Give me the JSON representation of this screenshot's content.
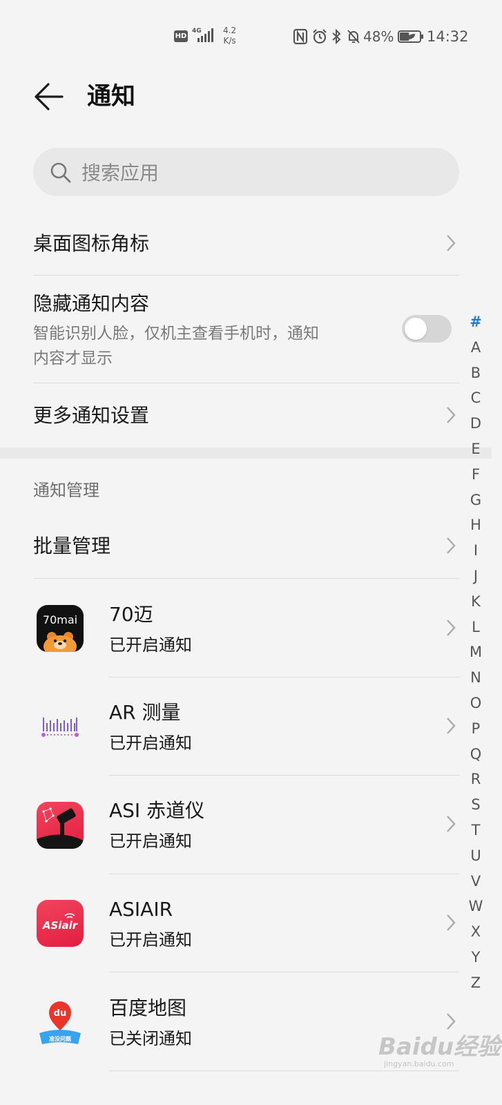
{
  "status_bar": {
    "hd": "HD",
    "network": "4G",
    "speed_value": "4.2",
    "speed_unit": "K/s",
    "battery": "48%",
    "battery_level": 0.48,
    "time": "14:32"
  },
  "header": {
    "title": "通知"
  },
  "search": {
    "placeholder": "搜索应用"
  },
  "settings": {
    "badge_label": "桌面图标角标",
    "hide_label": "隐藏通知内容",
    "hide_desc_line1": "智能识别人脸，仅机主查看手机时，通知",
    "hide_desc_line2": "内容才显示",
    "hide_toggle_on": false,
    "more_label": "更多通知设置"
  },
  "manage": {
    "section_title": "通知管理",
    "batch_label": "批量管理"
  },
  "apps": [
    {
      "name": "70迈",
      "status": "已开启通知",
      "icon": "70mai-logo",
      "icon_text": "70mai"
    },
    {
      "name": "AR 测量",
      "status": "已开启通知",
      "icon": "ar-measure-icon"
    },
    {
      "name": "ASI 赤道仪",
      "status": "已开启通知",
      "icon": "asi-mount-icon"
    },
    {
      "name": "ASIAIR",
      "status": "已开启通知",
      "icon": "asiair-logo",
      "icon_text": "ASiair"
    },
    {
      "name": "百度地图",
      "status": "已关闭通知",
      "icon": "baidu-map-logo",
      "icon_text": "du",
      "icon_subtext": "准没问题"
    }
  ],
  "alpha_index": [
    "#",
    "A",
    "B",
    "C",
    "D",
    "E",
    "F",
    "G",
    "H",
    "I",
    "J",
    "K",
    "L",
    "M",
    "N",
    "O",
    "P",
    "Q",
    "R",
    "S",
    "T",
    "U",
    "V",
    "W",
    "X",
    "Y",
    "Z"
  ],
  "watermark": {
    "text": "Baidu经验",
    "sub": "jingyan.baidu.com"
  },
  "colors": {
    "accent": "#1e7ad6",
    "background": "#f4f4f4"
  }
}
